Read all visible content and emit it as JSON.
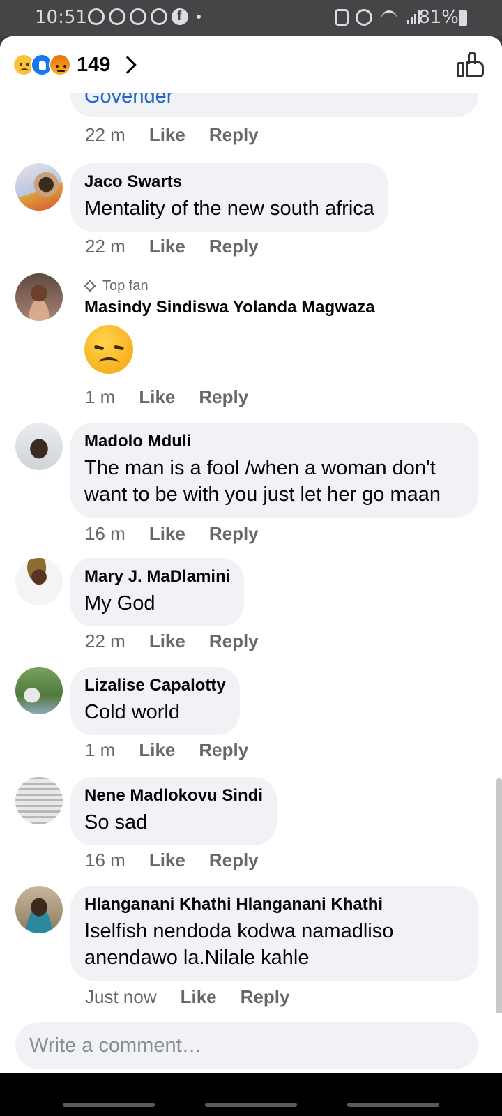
{
  "status_bar": {
    "time": "10:51",
    "battery": "81%"
  },
  "header": {
    "reaction_count": "149"
  },
  "top_partial": {
    "text": "Govender"
  },
  "comments": [
    {
      "time": "22 m"
    },
    {
      "name": "Jaco Swarts",
      "text": "Mentality of the new south africa",
      "time": "22 m"
    },
    {
      "badge": "Top fan",
      "name": "Masindy Sindiswa Yolanda Magwaza",
      "time": "1 m"
    },
    {
      "name": "Madolo Mduli",
      "text_line1": "The man is a fool /when a woman don't",
      "text_line2": "want to be with you just let her go maan",
      "time": "16 m"
    },
    {
      "name": "Mary J. MaDlamini",
      "text": "My God",
      "time": "22 m"
    },
    {
      "name": "Lizalise Capalotty",
      "text": "Cold world",
      "time": "1 m"
    },
    {
      "name": "Nene Madlokovu Sindi",
      "text": "So sad",
      "time": "16 m"
    },
    {
      "name": "Hlanganani Khathi Hlanganani Khathi",
      "text_line1": "Iselfish nendoda kodwa namadliso",
      "text_line2": "anendawo la.Nilale kahle",
      "time": "Just now"
    }
  ],
  "actions": {
    "like": "Like",
    "reply": "Reply"
  },
  "composer": {
    "placeholder": "Write a comment…"
  }
}
